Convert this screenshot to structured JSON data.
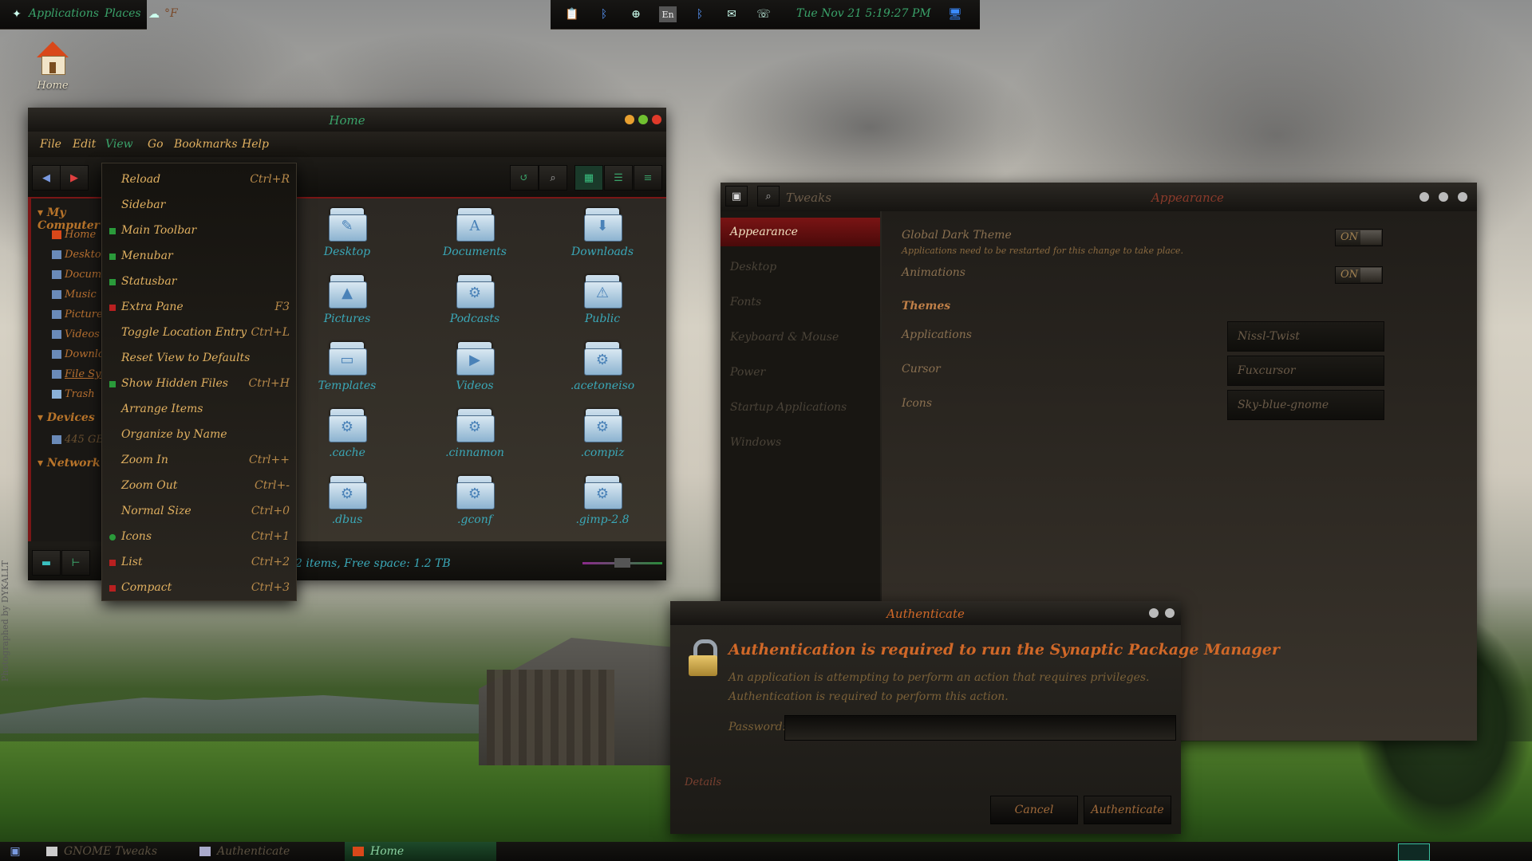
{
  "top_panel": {
    "applications": "Applications",
    "places": "Places",
    "weather": "°F",
    "clock": "Tue Nov 21   5:19:27 PM",
    "tray": [
      "clipboard-icon",
      "bluetooth-icon",
      "network-icon",
      "En",
      "bluetooth-icon",
      "mail-icon",
      "phone-icon",
      "monitor-icon"
    ],
    "lang": "En"
  },
  "desktop": {
    "home_label": "Home"
  },
  "file_manager": {
    "title": "Home",
    "menu": [
      "File",
      "Edit",
      "View",
      "Go",
      "Bookmarks",
      "Help"
    ],
    "sidebar": {
      "my_computer": "My Computer",
      "items": [
        "Home",
        "Desktop",
        "Documents",
        "Music",
        "Pictures",
        "Videos",
        "Downloads",
        "File System",
        "Trash"
      ],
      "devices": "Devices",
      "device_items": [
        "445 GB Volume"
      ],
      "network": "Network"
    },
    "files": [
      {
        "name": "Desktop",
        "glyph": "✎"
      },
      {
        "name": "Documents",
        "glyph": "A"
      },
      {
        "name": "Downloads",
        "glyph": "⬇"
      },
      {
        "name": "Pictures",
        "glyph": "▲"
      },
      {
        "name": "Podcasts",
        "glyph": "⚙"
      },
      {
        "name": "Public",
        "glyph": "⚠"
      },
      {
        "name": "Templates",
        "glyph": "▭"
      },
      {
        "name": "Videos",
        "glyph": "▶"
      },
      {
        "name": ".acetoneiso",
        "glyph": "⚙"
      },
      {
        "name": ".cache",
        "glyph": "⚙"
      },
      {
        "name": ".cinnamon",
        "glyph": "⚙"
      },
      {
        "name": ".compiz",
        "glyph": "⚙"
      },
      {
        "name": ".dbus",
        "glyph": "⚙"
      },
      {
        "name": ".gconf",
        "glyph": "⚙"
      },
      {
        "name": ".gimp-2.8",
        "glyph": "⚙"
      }
    ],
    "status": "2 items, Free space: 1.2 TB"
  },
  "view_menu": [
    {
      "label": "Reload",
      "accel": "Ctrl+R",
      "check": ""
    },
    {
      "label": "Sidebar",
      "accel": "",
      "check": ""
    },
    {
      "label": "Main Toolbar",
      "accel": "",
      "check": "green"
    },
    {
      "label": "Menubar",
      "accel": "",
      "check": "green"
    },
    {
      "label": "Statusbar",
      "accel": "",
      "check": "green"
    },
    {
      "label": "Extra Pane",
      "accel": "F3",
      "check": "red"
    },
    {
      "label": "Toggle Location Entry",
      "accel": "Ctrl+L",
      "check": ""
    },
    {
      "label": "Reset View to Defaults",
      "accel": "",
      "check": ""
    },
    {
      "label": "Show Hidden Files",
      "accel": "Ctrl+H",
      "check": "green"
    },
    {
      "label": "Arrange Items",
      "accel": "",
      "check": ""
    },
    {
      "label": "Organize by Name",
      "accel": "",
      "check": ""
    },
    {
      "label": "Zoom In",
      "accel": "Ctrl++",
      "check": ""
    },
    {
      "label": "Zoom Out",
      "accel": "Ctrl+-",
      "check": ""
    },
    {
      "label": "Normal Size",
      "accel": "Ctrl+0",
      "check": ""
    },
    {
      "label": "Icons",
      "accel": "Ctrl+1",
      "check": "dot"
    },
    {
      "label": "List",
      "accel": "Ctrl+2",
      "check": "red"
    },
    {
      "label": "Compact",
      "accel": "Ctrl+3",
      "check": "red"
    }
  ],
  "tweaks": {
    "app_title": "Tweaks",
    "section_title": "Appearance",
    "nav": [
      "Appearance",
      "Desktop",
      "Fonts",
      "Keyboard & Mouse",
      "Power",
      "Startup Applications",
      "Windows"
    ],
    "global_dark": "Global Dark Theme",
    "global_dark_note": "Applications need to be restarted for this change to take place.",
    "animations": "Animations",
    "toggle_on": "ON",
    "themes": "Themes",
    "theme_rows": [
      {
        "label": "Applications",
        "value": "Nissl-Twist"
      },
      {
        "label": "Cursor",
        "value": "Fuxcursor"
      },
      {
        "label": "Icons",
        "value": "Sky-blue-gnome"
      }
    ]
  },
  "auth": {
    "title": "Authenticate",
    "heading": "Authentication is required to run the Synaptic Package Manager",
    "line1": "An application is attempting to perform an action that requires privileges.",
    "line2": "Authentication is required to perform this action.",
    "password_label": "Password:",
    "details": "Details",
    "cancel": "Cancel",
    "authenticate": "Authenticate"
  },
  "taskbar": [
    "GNOME Tweaks",
    "Authenticate",
    "Home"
  ],
  "watermark": "Photographed by DYKALLT",
  "colors": {
    "accent_green": "#3aa36a",
    "accent_red": "#7a1616",
    "text_orange": "#e0b060"
  }
}
